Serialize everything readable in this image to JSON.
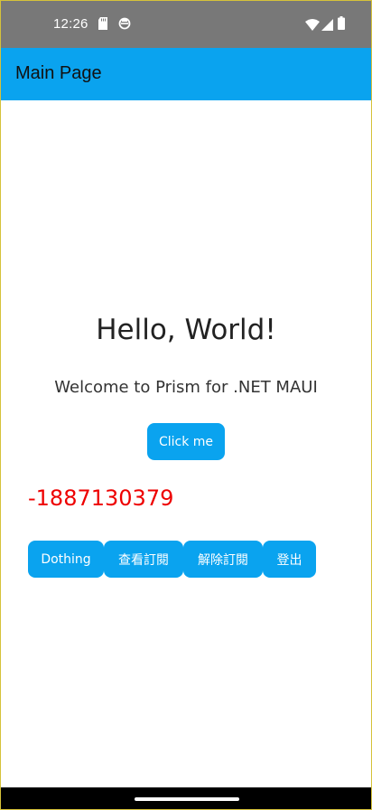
{
  "status_bar": {
    "time": "12:26",
    "left_icons": [
      "sd-card-icon",
      "sync-icon"
    ],
    "right_icons": [
      "wifi-icon",
      "signal-icon",
      "battery-icon"
    ]
  },
  "app_bar": {
    "title": "Main Page",
    "background": "#0aa3ef"
  },
  "main": {
    "heading": "Hello, World!",
    "subheading": "Welcome to Prism for .NET MAUI",
    "click_button_label": "Click me",
    "counter_value": "-1887130379",
    "counter_color": "#ee0000",
    "action_buttons": [
      {
        "label": "Dothing"
      },
      {
        "label": "查看訂閱"
      },
      {
        "label": "解除訂閱"
      },
      {
        "label": "登出"
      }
    ]
  },
  "colors": {
    "accent": "#0aa3ef",
    "status_bar": "#787878"
  }
}
